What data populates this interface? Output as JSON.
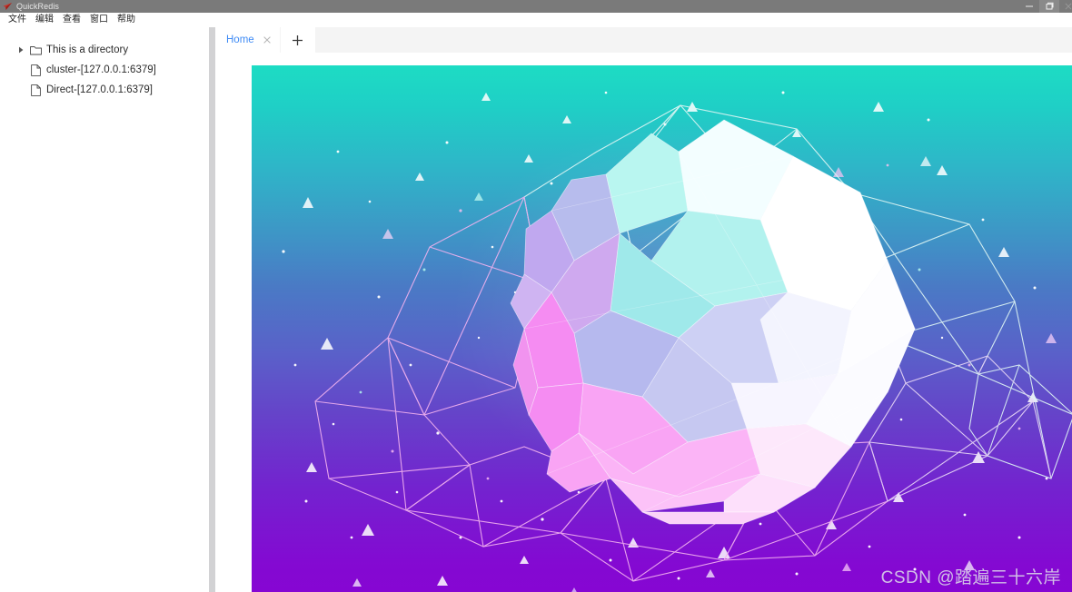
{
  "window": {
    "title": "QuickRedis",
    "logo_icon": "paper-plane-logo-icon",
    "controls": [
      {
        "name": "minimize-button",
        "icon": "minimize-icon"
      },
      {
        "name": "maximize-button",
        "icon": "maximize-icon"
      },
      {
        "name": "close-button",
        "icon": "close-icon"
      }
    ],
    "titlebar_bg": "#7a7a7a",
    "titlebar_text_color": "#e8e8e8"
  },
  "menubar": {
    "items": [
      {
        "label": "文件",
        "name": "menu-file"
      },
      {
        "label": "编辑",
        "name": "menu-edit"
      },
      {
        "label": "查看",
        "name": "menu-view"
      },
      {
        "label": "窗口",
        "name": "menu-window"
      },
      {
        "label": "帮助",
        "name": "menu-help"
      }
    ]
  },
  "sidebar": {
    "items": [
      {
        "label": "This is a directory",
        "icon": "folder-icon",
        "arrow": "chevron-right-icon",
        "type": "directory",
        "expanded": false,
        "indent": 0
      },
      {
        "label": "cluster-[127.0.0.1:6379]",
        "icon": "file-icon",
        "type": "connection",
        "indent": 1
      },
      {
        "label": "Direct-[127.0.0.1:6379]",
        "icon": "file-icon",
        "type": "connection",
        "indent": 1
      }
    ]
  },
  "tabs": {
    "active_index": 0,
    "items": [
      {
        "label": "Home",
        "name": "tab-home",
        "close_icon": "close-icon"
      }
    ],
    "new_tab": {
      "label": "+",
      "name": "new-tab-button",
      "icon": "plus-icon"
    },
    "active_tab_color": "#3f8bf5",
    "strip_bg": "#f4f4f4"
  },
  "main": {
    "hero": {
      "name": "home-hero-graphic",
      "description": "Faceted polyhedron sphere inside a wireframe cage on a teal-to-purple gradient with floating particles",
      "gradient_top": "#1ddcc4",
      "gradient_mid": "#4a7ac5",
      "gradient_bottom": "#8606d3",
      "sphere_colors": [
        "#ffffff",
        "#aaf4ec",
        "#cfd0f2",
        "#f9a8f0",
        "#f7c9f4"
      ],
      "cage_color": "#f0b8f0"
    },
    "watermark": "CSDN @踏遍三十六岸"
  }
}
